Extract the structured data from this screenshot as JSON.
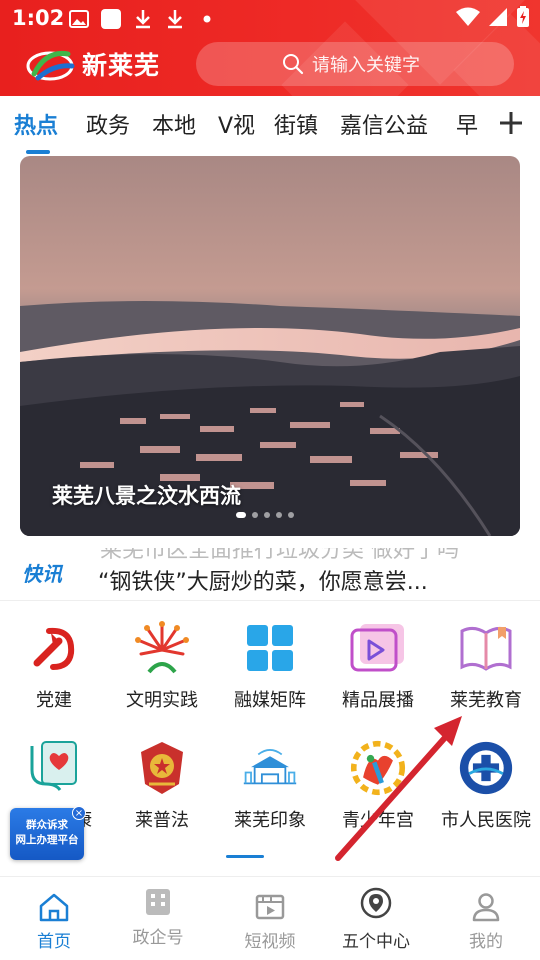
{
  "status_bar": {
    "time": "1:02"
  },
  "header": {
    "app_name": "新莱芜",
    "search_placeholder": "请输入关键字"
  },
  "tabs": [
    {
      "label": "热点",
      "active": true
    },
    {
      "label": "政务"
    },
    {
      "label": "本地"
    },
    {
      "label": "V视"
    },
    {
      "label": "街镇"
    },
    {
      "label": "嘉信公益"
    },
    {
      "label": "早"
    }
  ],
  "banner": {
    "caption": "莱芜八景之汶水西流",
    "slides": 5,
    "active_slide": 1
  },
  "flash": {
    "label": "快讯",
    "text": "“钢铁侠”大厨炒的菜，你愿意尝...",
    "prev_text": "莱芜市区全面推行垃圾分类 做好了吗"
  },
  "grid": [
    {
      "label": "党建",
      "icon": "party-icon"
    },
    {
      "label": "文明实践",
      "icon": "civilization-icon"
    },
    {
      "label": "融媒矩阵",
      "icon": "matrix-icon"
    },
    {
      "label": "精品展播",
      "icon": "video-play-icon"
    },
    {
      "label": "莱芜教育",
      "icon": "book-icon"
    },
    {
      "label": "健康",
      "icon": "health-icon"
    },
    {
      "label": "莱普法",
      "icon": "law-emblem-icon"
    },
    {
      "label": "莱芜印象",
      "icon": "city-gate-icon"
    },
    {
      "label": "青少年宫",
      "icon": "youth-palace-icon"
    },
    {
      "label": "市人民医院",
      "icon": "hospital-logo-icon"
    }
  ],
  "float_badge": {
    "line1": "群众诉求",
    "line2": "网上办理平台"
  },
  "bottom_nav": [
    {
      "label": "首页",
      "active": true,
      "icon": "home-icon"
    },
    {
      "label": "政企号",
      "icon": "building-icon"
    },
    {
      "label": "短视频",
      "icon": "film-icon"
    },
    {
      "label": "五个中心",
      "icon": "location-pin-icon"
    },
    {
      "label": "我的",
      "icon": "user-icon"
    }
  ],
  "colors": {
    "brand_red": "#e8201e",
    "accent_blue": "#1a7fd4",
    "arrow_red": "#d4252f"
  }
}
